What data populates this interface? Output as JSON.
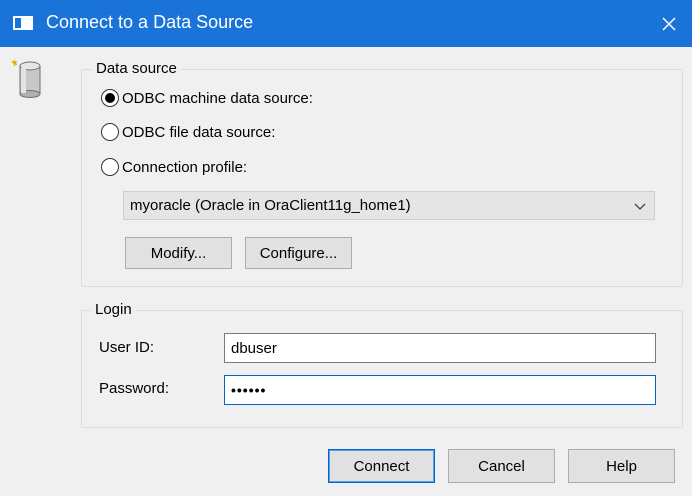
{
  "window": {
    "title": "Connect to a Data Source",
    "title_icon": "window-icon",
    "close_icon": "close-icon",
    "accent_color": "#1a73d9"
  },
  "app_icon": "database-icon",
  "data_source": {
    "group_label": "Data source",
    "options": [
      {
        "label": "ODBC machine data source:",
        "selected": true
      },
      {
        "label": "ODBC file data source:",
        "selected": false
      },
      {
        "label": "Connection profile:",
        "selected": false
      }
    ],
    "selected_value": "myoracle (Oracle in OraClient11g_home1)",
    "modify_label": "Modify...",
    "configure_label": "Configure..."
  },
  "login": {
    "group_label": "Login",
    "user_id_label": "User ID:",
    "user_id_value": "dbuser",
    "password_label": "Password:",
    "password_value": "••••••"
  },
  "buttons": {
    "connect": "Connect",
    "cancel": "Cancel",
    "help": "Help"
  }
}
